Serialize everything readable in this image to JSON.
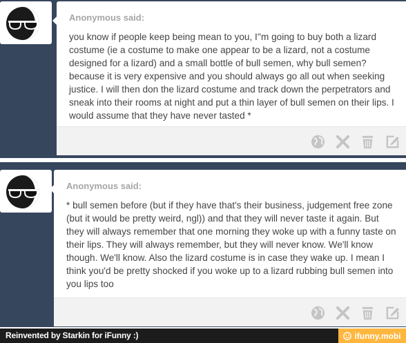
{
  "posts": [
    {
      "author": "Anonymous said:",
      "text": "you know if people keep being mean to you, I''m going to buy both a lizard costume (ie a costume to make one appear to be a lizard, not a costume designed for a lizard) and a small bottle of bull semen, why bull semen? because it is very expensive and you should always go all out when seeking justice. I will then don the lizard costume and track down the perpetrators and sneak into their rooms at night and put a thin layer of bull semen on their lips. I would assume that they have never tasted *"
    },
    {
      "author": "Anonymous said:",
      "text": "* bull semen before (but if they have that's their business, judgement free zone (but it would be pretty weird, ngl)) and that they will never taste it again. But they will always remember that one morning they woke up with a funny taste on their lips. They will always remember, but they will never know. We'll know though. We'll know. Also the lizard costume is in case they wake up. I mean I think you'd be pretty shocked if you woke up to a lizard rubbing bull semen into you lips too"
    }
  ],
  "actions": [
    "globe-icon",
    "delete-icon",
    "trash-icon",
    "edit-icon"
  ],
  "footer": {
    "credit": "Reinvented by Starkin for iFunny :)",
    "watermark": "ifunny.mobi"
  },
  "colors": {
    "dashboard_bg": "#36465d",
    "card_bg": "#ffffff",
    "footer_bg": "#f2f2f2",
    "icon": "#c4c4c4",
    "watermark_bg": "#ffb63e"
  }
}
